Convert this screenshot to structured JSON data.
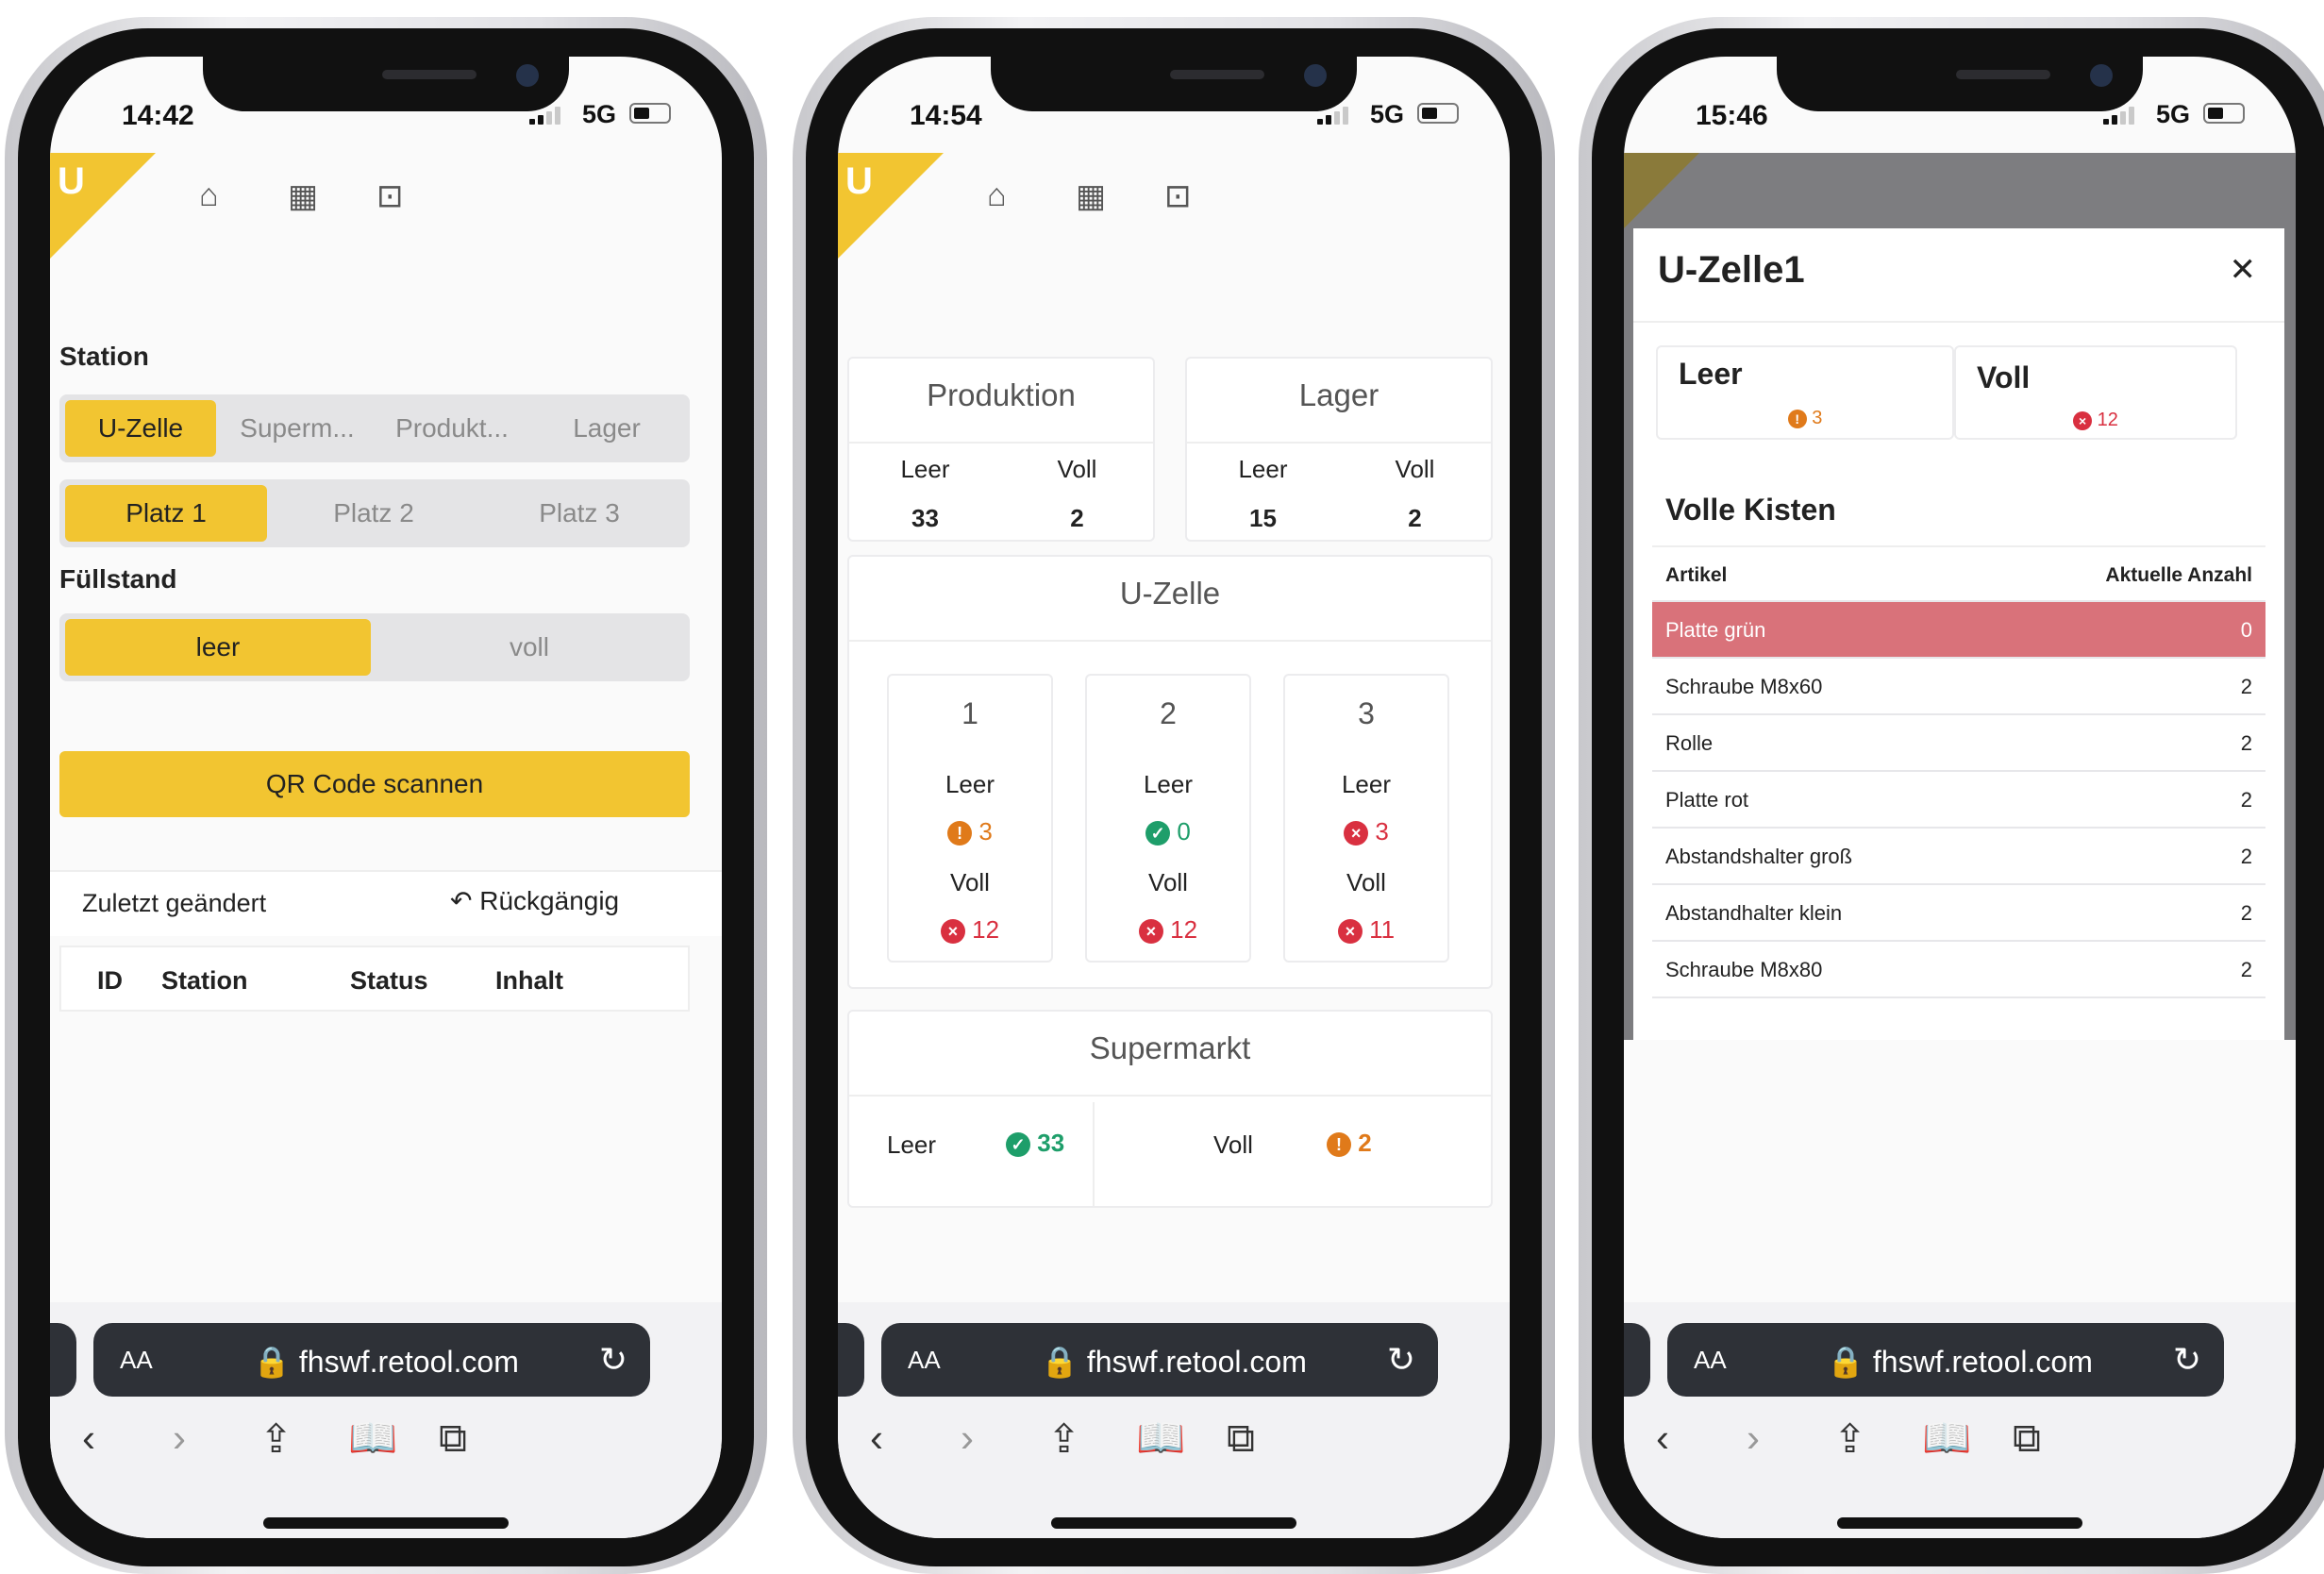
{
  "url": "fhswf.retool.com",
  "aa": "AA",
  "net": "5G",
  "p1": {
    "time": "14:42",
    "station": "Station",
    "stations": [
      "U-Zelle",
      "Superm...",
      "Produkt...",
      "Lager"
    ],
    "plaetze": [
      "Platz 1",
      "Platz 2",
      "Platz 3"
    ],
    "fuellstand": "Füllstand",
    "fuell": [
      "leer",
      "voll"
    ],
    "qr": "QR Code scannen",
    "last": "Zuletzt geändert",
    "undo": "Rückgängig",
    "cols": [
      "ID",
      "Station",
      "Status",
      "Inhalt"
    ]
  },
  "p2": {
    "time": "14:54",
    "prod": {
      "t": "Produktion",
      "l": "Leer",
      "v": "Voll",
      "lv": "33",
      "vv": "2"
    },
    "lager": {
      "t": "Lager",
      "l": "Leer",
      "v": "Voll",
      "lv": "15",
      "vv": "2"
    },
    "uz": "U-Zelle",
    "cells": [
      {
        "n": "1",
        "l": "Leer",
        "lv": "3",
        "v": "Voll",
        "vv": "12"
      },
      {
        "n": "2",
        "l": "Leer",
        "lv": "0",
        "v": "Voll",
        "vv": "12"
      },
      {
        "n": "3",
        "l": "Leer",
        "lv": "3",
        "v": "Voll",
        "vv": "11"
      }
    ],
    "sm": {
      "t": "Supermarkt",
      "l": "Leer",
      "lv": "33",
      "v": "Voll",
      "vv": "2"
    }
  },
  "p3": {
    "time": "15:46",
    "title": "U-Zelle1",
    "close": "✕",
    "leer": "Leer",
    "lv": "3",
    "voll": "Voll",
    "vv": "12",
    "vk": "Volle Kisten",
    "h1": "Artikel",
    "h2": "Aktuelle Anzahl",
    "rows": [
      {
        "a": "Platte grün",
        "n": "0"
      },
      {
        "a": "Schraube M8x60",
        "n": "2"
      },
      {
        "a": "Rolle",
        "n": "2"
      },
      {
        "a": "Platte rot",
        "n": "2"
      },
      {
        "a": "Abstandshalter groß",
        "n": "2"
      },
      {
        "a": "Abstandhalter klein",
        "n": "2"
      },
      {
        "a": "Schraube M8x80",
        "n": "2"
      }
    ]
  },
  "colors": {
    "accent": "#f2c531",
    "ok": "#1e9e6a",
    "error": "#d93040",
    "warn": "#e07a1a",
    "highlight": "#d9727a"
  }
}
